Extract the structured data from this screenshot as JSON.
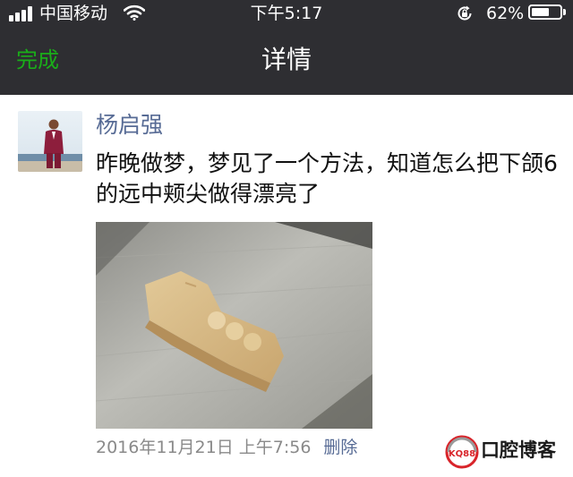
{
  "status_bar": {
    "carrier": "中国移动",
    "time": "下午5:17",
    "battery_percent": "62%",
    "battery_level": 0.62,
    "icons": [
      "signal-bars-icon",
      "wifi-icon",
      "rotation-lock-icon",
      "battery-icon"
    ]
  },
  "nav": {
    "done_label": "完成",
    "title": "详情"
  },
  "post": {
    "author": "杨启强",
    "text": "昨晚做梦，梦见了一个方法，知道怎么把下颌6的远中颊尖做得漂亮了",
    "image_alt": "tooth-wax-model-photo",
    "timestamp": "2016年11月21日 上午7:56",
    "delete_label": "删除"
  },
  "watermark": {
    "logo_text": "KQ88",
    "brand": "口腔博客"
  },
  "colors": {
    "topbar": "#2e2e32",
    "done_green": "#1aad19",
    "link_blue": "#576b95",
    "meta_gray": "#8a8a8a"
  }
}
